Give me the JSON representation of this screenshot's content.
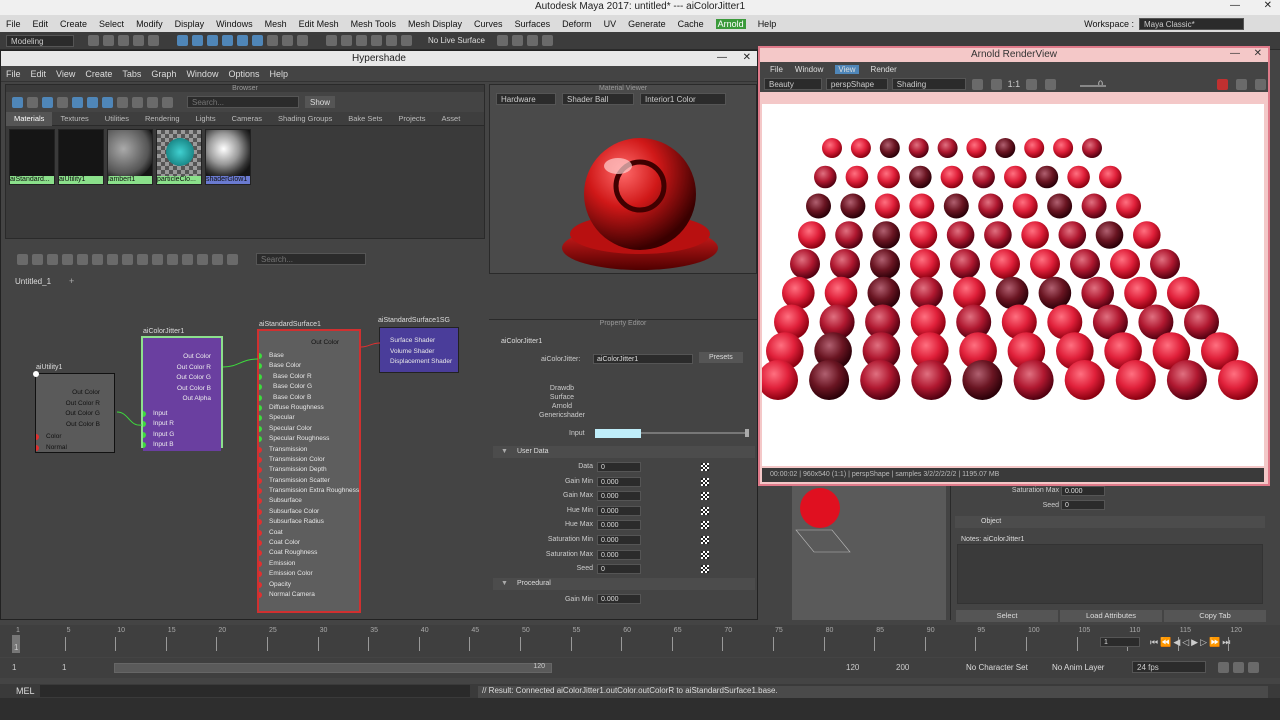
{
  "app": {
    "title": "Autodesk Maya 2017: untitled*   ---   aiColorJitter1",
    "menus": [
      "File",
      "Edit",
      "Create",
      "Select",
      "Modify",
      "Display",
      "Windows",
      "Mesh",
      "Edit Mesh",
      "Mesh Tools",
      "Mesh Display",
      "Curves",
      "Surfaces",
      "Deform",
      "UV",
      "Generate",
      "Cache",
      "Arnold",
      "Help"
    ],
    "workspace_label": "Workspace :",
    "workspace_value": "Maya Classic*",
    "mode": "Modeling",
    "live_surface": "No Live Surface"
  },
  "hypershade": {
    "title": "Hypershade",
    "menus": [
      "File",
      "Edit",
      "View",
      "Create",
      "Tabs",
      "Graph",
      "Window",
      "Options",
      "Help"
    ],
    "browser_label": "Browser",
    "search_placeholder": "Search...",
    "show_label": "Show",
    "tabs": [
      "Materials",
      "Textures",
      "Utilities",
      "Rendering",
      "Lights",
      "Cameras",
      "Shading Groups",
      "Bake Sets",
      "Projects",
      "Asset"
    ],
    "materials": [
      {
        "name": "aiStandard...",
        "kind": "dark"
      },
      {
        "name": "aiUtility1",
        "kind": "dark"
      },
      {
        "name": "lambert1",
        "kind": "grey"
      },
      {
        "name": "particleClo...",
        "kind": "checker"
      },
      {
        "name": "shaderGlow1",
        "kind": "chrome"
      }
    ],
    "graph_tab": "Untitled_1",
    "graph_search_placeholder": "Search..."
  },
  "nodes": {
    "utility": {
      "title": "aiUtility1",
      "outs": [
        "Out Color",
        "Out Color R",
        "Out Color G",
        "Out Color B"
      ],
      "ins": [
        "Color",
        "Normal"
      ]
    },
    "jitter": {
      "title": "aiColorJitter1",
      "outs": [
        "Out Color",
        "Out Color R",
        "Out Color G",
        "Out Color B",
        "Out Alpha"
      ],
      "ins": [
        "Input",
        "Input R",
        "Input G",
        "Input B"
      ]
    },
    "standard": {
      "title": "aiStandardSurface1",
      "top": "Out Color",
      "rows": [
        "Base",
        "Base Color",
        "Base Color R",
        "Base Color G",
        "Base Color B",
        "Diffuse Roughness",
        "Specular",
        "Specular Color",
        "Specular Roughness",
        "Transmission",
        "Transmission Color",
        "Transmission Depth",
        "Transmission Scatter",
        "Transmission Extra Roughness",
        "Subsurface",
        "Subsurface Color",
        "Subsurface Radius",
        "Coat",
        "Coat Color",
        "Coat Roughness",
        "Emission",
        "Emission Color",
        "Opacity",
        "Normal Camera"
      ]
    },
    "sg": {
      "title": "aiStandardSurface1SG",
      "rows": [
        "Surface Shader",
        "Volume Shader",
        "Displacement Shader"
      ]
    }
  },
  "material_viewer": {
    "label": "Material Viewer",
    "renderer": "Hardware",
    "shape": "Shader Ball",
    "env": "Interior1 Color"
  },
  "property_editor": {
    "label": "Property Editor",
    "node_name": "aiColorJitter1",
    "field_label": "aiColorJitter:",
    "field_value": "aiColorJitter1",
    "presets_label": "Presets",
    "drawdb_lines": [
      "Drawdb",
      "Surface",
      "Arnold",
      "Genericshader"
    ],
    "input_label": "Input",
    "input_color": "#bfeefa",
    "user_data_label": "User Data",
    "attrs": [
      {
        "label": "Data",
        "value": "0"
      },
      {
        "label": "Gain Min",
        "value": "0.000"
      },
      {
        "label": "Gain Max",
        "value": "0.000"
      },
      {
        "label": "Hue Min",
        "value": "0.000"
      },
      {
        "label": "Hue Max",
        "value": "0.000"
      },
      {
        "label": "Saturation Min",
        "value": "0.000"
      },
      {
        "label": "Saturation Max",
        "value": "0.000"
      },
      {
        "label": "Seed",
        "value": "0"
      }
    ],
    "procedural_label": "Procedural",
    "proc_gain_min_label": "Gain Min",
    "proc_gain_min_value": "0.000"
  },
  "render_view": {
    "title": "Arnold RenderView",
    "menus": [
      "File",
      "Window",
      "View",
      "Render"
    ],
    "aov": "Beauty",
    "camera": "perspShape",
    "mode": "Shading",
    "ratio": "1:1",
    "exposure": "0",
    "status": "00:00:02 | 960x540 (1:1) | perspShape | samples 3/2/2/2/2/2 | 1195.07 MB"
  },
  "attribute_editor": {
    "saturation_max_label": "Saturation Max",
    "saturation_max_value": "0.000",
    "seed_label": "Seed",
    "seed_value": "0",
    "object_label": "Object",
    "notes_label": "Notes: aiColorJitter1",
    "buttons": [
      "Select",
      "Load Attributes",
      "Copy Tab"
    ]
  },
  "timeline": {
    "ticks": [
      "1",
      "5",
      "10",
      "15",
      "20",
      "25",
      "30",
      "35",
      "40",
      "45",
      "50",
      "55",
      "60",
      "65",
      "70",
      "75",
      "80",
      "85",
      "90",
      "95",
      "100",
      "105",
      "110",
      "115",
      "120"
    ],
    "current_frame": "1",
    "range_start": "1",
    "range_start2": "1",
    "range_inner_end": "120",
    "range_end": "120",
    "range_end2": "200",
    "character_set": "No Character Set",
    "anim_layer": "No Anim Layer",
    "fps": "24 fps"
  },
  "command_line": {
    "lang": "MEL",
    "result": "// Result: Connected aiColorJitter1.outColor.outColorR to aiStandardSurface1.base."
  },
  "colors": {
    "accent": "#4f86b8",
    "render_border": "#e07a8a",
    "node_purple": "#6a3fa0",
    "node_red": "#d03030"
  }
}
